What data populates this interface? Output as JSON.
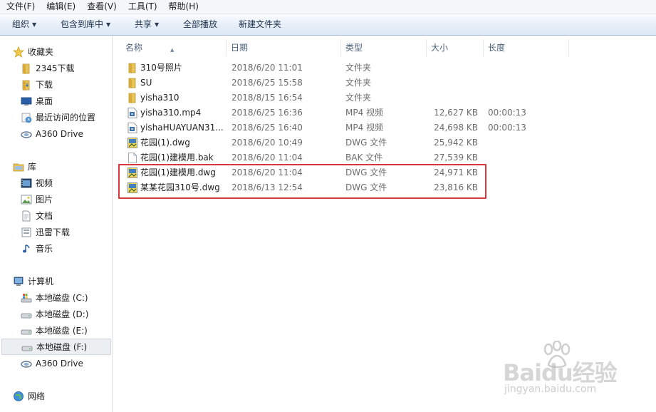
{
  "menubar": {
    "items": [
      "文件(F)",
      "编辑(E)",
      "查看(V)",
      "工具(T)",
      "帮助(H)"
    ]
  },
  "toolbar": {
    "organize": "组织",
    "include_library": "包含到库中",
    "share": "共享",
    "play_all": "全部播放",
    "new_folder": "新建文件夹",
    "arrow": "▼"
  },
  "nav": {
    "favorites": "收藏夹",
    "fav_items": [
      "2345下载",
      "下载",
      "桌面",
      "最近访问的位置",
      "A360 Drive"
    ],
    "libraries": "库",
    "lib_items": [
      "视频",
      "图片",
      "文档",
      "迅雷下载",
      "音乐"
    ],
    "computer": "计算机",
    "comp_items": [
      "本地磁盘 (C:)",
      "本地磁盘 (D:)",
      "本地磁盘 (E:)",
      "本地磁盘 (F:)",
      "A360 Drive"
    ],
    "network": "网络"
  },
  "columns": {
    "name": "名称",
    "date": "日期",
    "type": "类型",
    "size": "大小",
    "length": "长度",
    "sort_indicator": "▲"
  },
  "files": [
    {
      "name": "310号照片",
      "date": "2018/6/20 11:01",
      "type": "文件夹",
      "size": "",
      "length": "",
      "icon": "folder-icon"
    },
    {
      "name": "SU",
      "date": "2018/6/25 15:58",
      "type": "文件夹",
      "size": "",
      "length": "",
      "icon": "folder-icon"
    },
    {
      "name": "yisha310",
      "date": "2018/8/15 16:54",
      "type": "文件夹",
      "size": "",
      "length": "",
      "icon": "folder-icon"
    },
    {
      "name": "yisha310.mp4",
      "date": "2018/6/25 16:36",
      "type": "MP4 视频",
      "size": "12,627 KB",
      "length": "00:00:13",
      "icon": "video-file-icon"
    },
    {
      "name": "yishaHUAYUAN31...",
      "date": "2018/6/25 16:40",
      "type": "MP4 视频",
      "size": "24,698 KB",
      "length": "00:00:13",
      "icon": "video-file-icon"
    },
    {
      "name": "花园(1).dwg",
      "date": "2018/6/20 10:49",
      "type": "DWG 文件",
      "size": "25,942 KB",
      "length": "",
      "icon": "dwg-file-icon"
    },
    {
      "name": "花园(1)建模用.bak",
      "date": "2018/6/20 11:04",
      "type": "BAK 文件",
      "size": "27,539 KB",
      "length": "",
      "icon": "blank-file-icon"
    },
    {
      "name": "花园(1)建模用.dwg",
      "date": "2018/6/20 11:04",
      "type": "DWG 文件",
      "size": "24,971 KB",
      "length": "",
      "icon": "dwg-file-icon"
    },
    {
      "name": "某某花园310号.dwg",
      "date": "2018/6/13 12:54",
      "type": "DWG 文件",
      "size": "23,816 KB",
      "length": "",
      "icon": "dwg-file-icon"
    }
  ],
  "watermark": {
    "brand": "Baidu经验",
    "url": "jingyan.baidu.com"
  },
  "colors": {
    "highlight_border": "#d8383a",
    "folder": "#e8c35a",
    "toolbar_bg": "#dce7f4"
  }
}
